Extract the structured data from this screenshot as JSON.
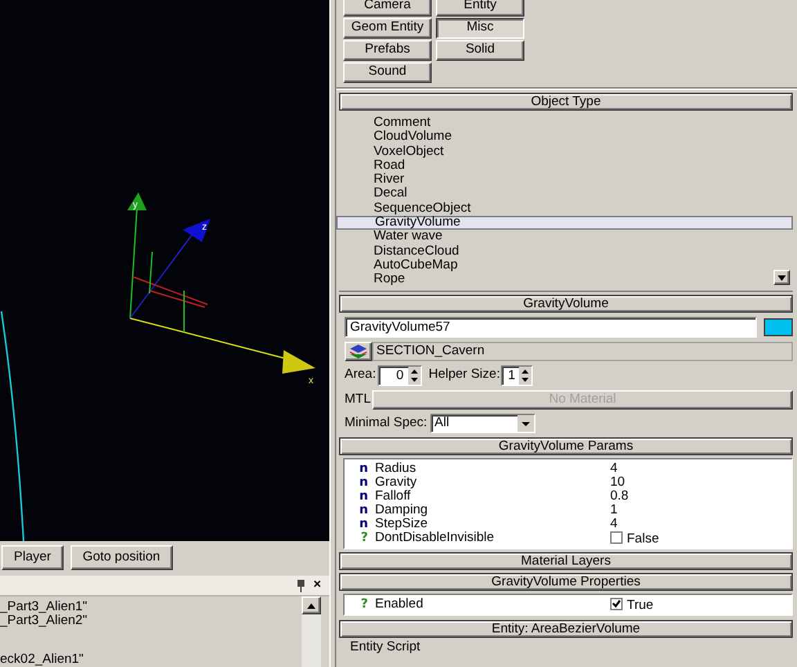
{
  "viewport": {
    "axis_labels": [
      "y",
      "z",
      "x"
    ]
  },
  "viewport_buttons": [
    {
      "label": "Player"
    },
    {
      "label": "Goto position"
    }
  ],
  "console_panel": {
    "close": "×",
    "lines": [
      "_Part3_Alien1\"",
      "_Part3_Alien2\""
    ],
    "lower_lines": [
      "eck02_Alien1\""
    ]
  },
  "create_buttons": [
    {
      "label": "Camera",
      "selected": false
    },
    {
      "label": "Entity",
      "selected": false
    },
    {
      "label": "Geom Entity",
      "selected": false
    },
    {
      "label": "Misc",
      "selected": true
    },
    {
      "label": "Prefabs",
      "selected": false
    },
    {
      "label": "Solid",
      "selected": false
    },
    {
      "label": "Sound",
      "selected": false
    }
  ],
  "object_type": {
    "title": "Object Type",
    "items": [
      {
        "label": "Comment",
        "selected": false
      },
      {
        "label": "CloudVolume",
        "selected": false
      },
      {
        "label": "VoxelObject",
        "selected": false
      },
      {
        "label": "Road",
        "selected": false
      },
      {
        "label": "River",
        "selected": false
      },
      {
        "label": "Decal",
        "selected": false
      },
      {
        "label": "SequenceObject",
        "selected": false
      },
      {
        "label": "GravityVolume",
        "selected": true
      },
      {
        "label": "Water wave",
        "selected": false
      },
      {
        "label": "DistanceCloud",
        "selected": false
      },
      {
        "label": "AutoCubeMap",
        "selected": false
      },
      {
        "label": "Rope",
        "selected": false
      }
    ]
  },
  "object_panel": {
    "title": "GravityVolume",
    "name": "GravityVolume57",
    "color": "#00c0f0",
    "layer": "SECTION_Cavern",
    "area_label": "Area:",
    "area": "0",
    "helper_label": "Helper Size:",
    "helper_size": "1",
    "mtl_label": "MTL",
    "material": "No Material",
    "spec_label": "Minimal Spec:",
    "spec": "All"
  },
  "params": {
    "title": "GravityVolume Params",
    "rows": [
      {
        "kind": "number",
        "icon": "n",
        "name": "Radius",
        "value": "4"
      },
      {
        "kind": "number",
        "icon": "n",
        "name": "Gravity",
        "value": "10"
      },
      {
        "kind": "number",
        "icon": "n",
        "name": "Falloff",
        "value": "0.8"
      },
      {
        "kind": "number",
        "icon": "n",
        "name": "Damping",
        "value": "1"
      },
      {
        "kind": "number",
        "icon": "n",
        "name": "StepSize",
        "value": "4"
      },
      {
        "kind": "bool",
        "icon": "?",
        "name": "DontDisableInvisible",
        "checked": false,
        "value": "False"
      }
    ]
  },
  "material_layers": {
    "title": "Material Layers"
  },
  "properties": {
    "title": "GravityVolume Properties",
    "rows": [
      {
        "kind": "bool",
        "icon": "?",
        "name": "Enabled",
        "checked": true,
        "value": "True"
      }
    ]
  },
  "entity": {
    "title": "Entity: AreaBezierVolume",
    "subtitle": "Entity Script"
  }
}
